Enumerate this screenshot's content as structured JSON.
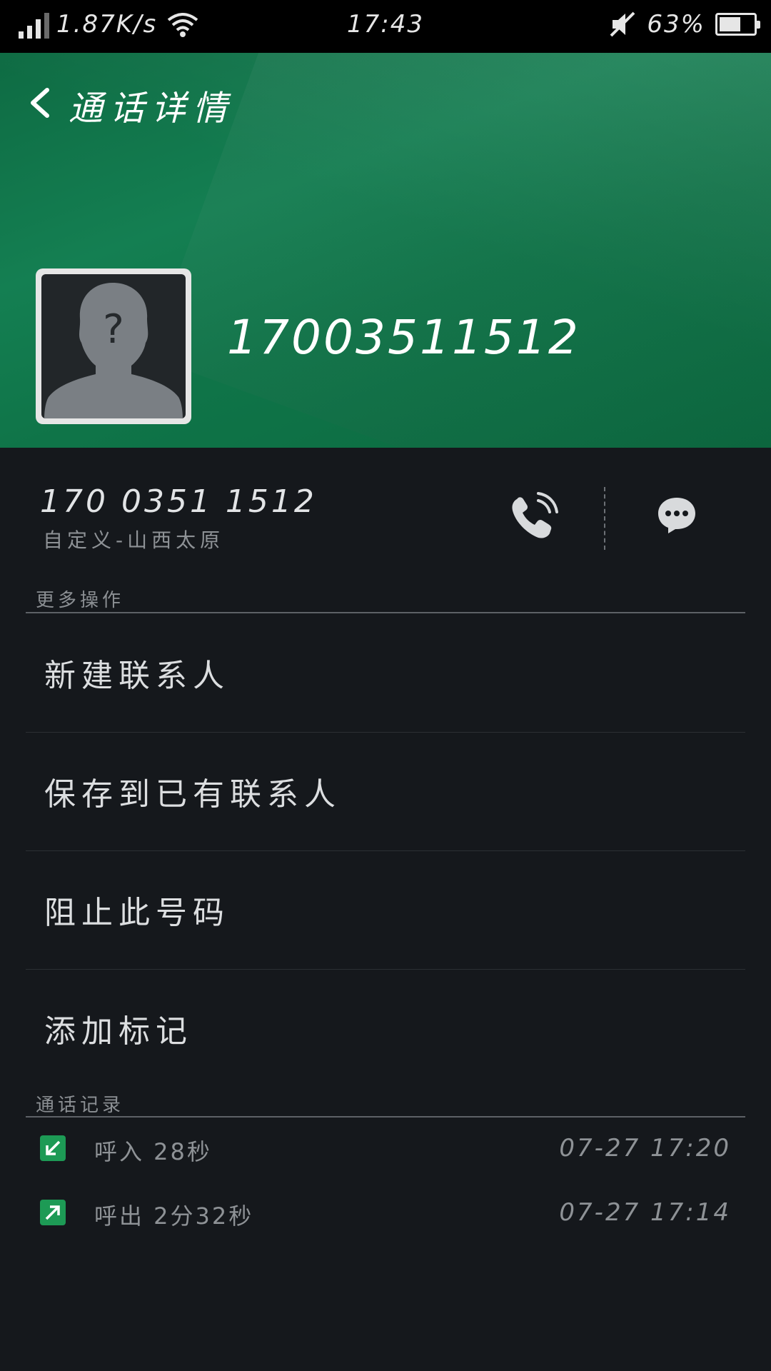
{
  "status_bar": {
    "net_speed": "1.87K/s",
    "time": "17:43",
    "battery_percent": "63%",
    "battery_level": 0.63
  },
  "header": {
    "title": "通话详情",
    "display_number": "17003511512"
  },
  "contact": {
    "formatted_number": "170 0351 1512",
    "location": "自定义-山西太原"
  },
  "sections": {
    "more_actions": "更多操作",
    "call_log": "通话记录"
  },
  "actions": [
    {
      "label": "新建联系人"
    },
    {
      "label": "保存到已有联系人"
    },
    {
      "label": "阻止此号码"
    },
    {
      "label": "添加标记"
    }
  ],
  "call_log": [
    {
      "type": "incoming",
      "icon": "incoming-call-icon",
      "text": "呼入 28秒",
      "time": "07-27 17:20"
    },
    {
      "type": "outgoing",
      "icon": "outgoing-call-icon",
      "text": "呼出 2分32秒",
      "time": "07-27 17:14"
    }
  ],
  "colors": {
    "header_green": "#0f7448",
    "background": "#15181c",
    "log_icon_green": "#1d9a55"
  }
}
